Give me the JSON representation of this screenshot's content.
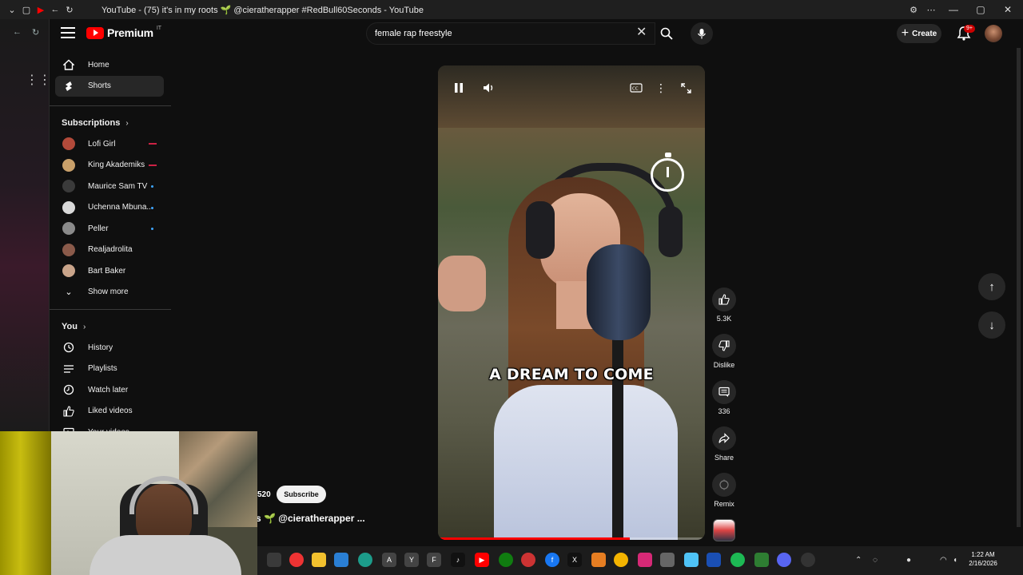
{
  "browser": {
    "tab_title": "YouTube - (75) it's in my roots 🌱 @cieratherapper #RedBull60Seconds - YouTube"
  },
  "header": {
    "logo_text": "Premium",
    "logo_sup": "IT",
    "search_value": "female rap freestyle",
    "create_label": "Create",
    "notif_badge": "9+"
  },
  "sidebar": {
    "main": [
      {
        "label": "Home",
        "icon": "home-icon"
      },
      {
        "label": "Shorts",
        "icon": "shorts-icon",
        "active": true
      }
    ],
    "subscriptions_title": "Subscriptions",
    "subscriptions": [
      {
        "label": "Lofi Girl",
        "status": "live",
        "color": "#b34a3a"
      },
      {
        "label": "King Akademiks",
        "status": "live",
        "color": "#c9a06a"
      },
      {
        "label": "Maurice Sam TV",
        "status": "new",
        "color": "#3a3a3a"
      },
      {
        "label": "Uchenna Mbuna...",
        "status": "new",
        "color": "#d9d9d9"
      },
      {
        "label": "Peller",
        "status": "new",
        "color": "#8a8a8a"
      },
      {
        "label": "Realjadrolita",
        "status": "",
        "color": "#8a5a4a"
      },
      {
        "label": "Bart Baker",
        "status": "",
        "color": "#c9a48a"
      }
    ],
    "show_more": "Show more",
    "you_title": "You",
    "you_items": [
      {
        "label": "History",
        "icon": "history-icon"
      },
      {
        "label": "Playlists",
        "icon": "playlists-icon"
      },
      {
        "label": "Watch later",
        "icon": "watch-later-icon"
      },
      {
        "label": "Liked videos",
        "icon": "liked-videos-icon"
      },
      {
        "label": "Your videos",
        "icon": "your-videos-icon"
      }
    ]
  },
  "player": {
    "caption": "A DREAM TO COME",
    "progress": 0.72
  },
  "actions": {
    "like_count": "5.3K",
    "dislike_label": "Dislike",
    "comments_count": "336",
    "share_label": "Share",
    "remix_label": "Remix"
  },
  "channel": {
    "subscriber_fragment": "520",
    "subscribe_label": "Subscribe",
    "handle": "s 🌱 @cieratherapper  ..."
  },
  "taskbar": {
    "time": "1:22 AM",
    "date": "2/16/2026"
  },
  "colors": {
    "accent": "#ff0000",
    "background": "#0f0f0f",
    "chip": "#272727"
  }
}
